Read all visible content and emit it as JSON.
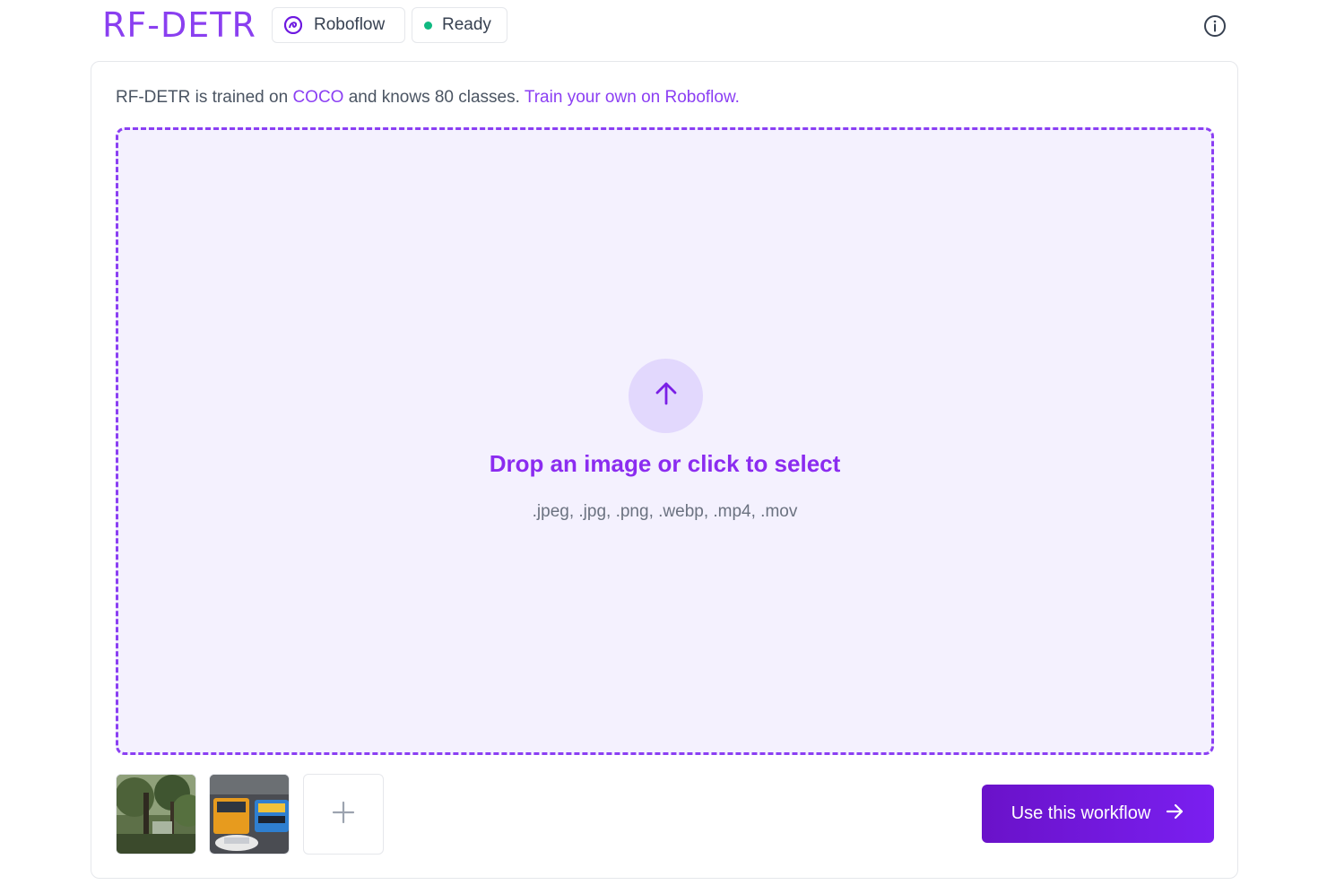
{
  "header": {
    "brand": "RF-DETR",
    "roboflow_chip": {
      "label": "Roboflow",
      "icon": "roboflow-logo-icon"
    },
    "status_chip": {
      "label": "Ready",
      "dot_color": "#10b981"
    },
    "info_icon": "info-icon"
  },
  "intro": {
    "prefix": "RF-DETR is trained on ",
    "coco_link": "COCO",
    "middle": " and knows 80 classes. ",
    "train_link": "Train your own on Roboflow."
  },
  "dropzone": {
    "icon": "arrow-up-icon",
    "title": "Drop an image or click to select",
    "formats": ".jpeg, .jpg, .png, .webp, .mp4, .mov"
  },
  "samples": {
    "items": [
      {
        "name": "forest-sample",
        "icon": "forest-thumbnail"
      },
      {
        "name": "street-sample",
        "icon": "buses-street-thumbnail"
      }
    ],
    "add_icon": "plus-icon"
  },
  "cta": {
    "label": "Use this workflow",
    "icon": "arrow-right-icon"
  },
  "colors": {
    "accent": "#8b3ff3",
    "dropzone_bg": "#f4f1fe",
    "button": "#6a12c9",
    "status": "#10b981"
  }
}
